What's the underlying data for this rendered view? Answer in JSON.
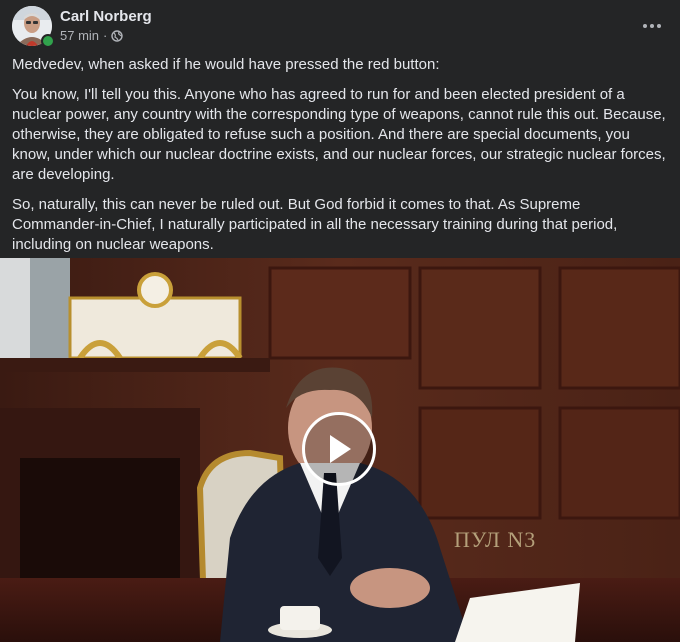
{
  "post": {
    "author": "Carl Norberg",
    "time": "57 min",
    "separator": "·",
    "privacy_icon": "globe-icon",
    "more_icon": "more-horizontal-icon",
    "paragraphs": [
      "Medvedev, when asked if he would have pressed the red button:",
      "You know, I'll tell you this. Anyone who has agreed to run for and been elected president of a nuclear power, any country with the corresponding type of weapons, cannot rule this out. Because, otherwise, they are obligated to refuse such a position. And there are special documents, you know, under which our nuclear doctrine exists, and our nuclear forces, our strategic nuclear forces, are developing.",
      "So, naturally, this can never be ruled out. But God forbid it comes to that. As Supreme Commander-in-Chief, I naturally participated in all the necessary training during that period, including on nuclear weapons."
    ]
  },
  "video": {
    "watermark": "ПУЛ N3",
    "play_icon": "play-icon"
  },
  "colors": {
    "background": "#242526",
    "text": "#e4e6eb",
    "secondary_text": "#b0b3b8",
    "online": "#31a24c"
  }
}
